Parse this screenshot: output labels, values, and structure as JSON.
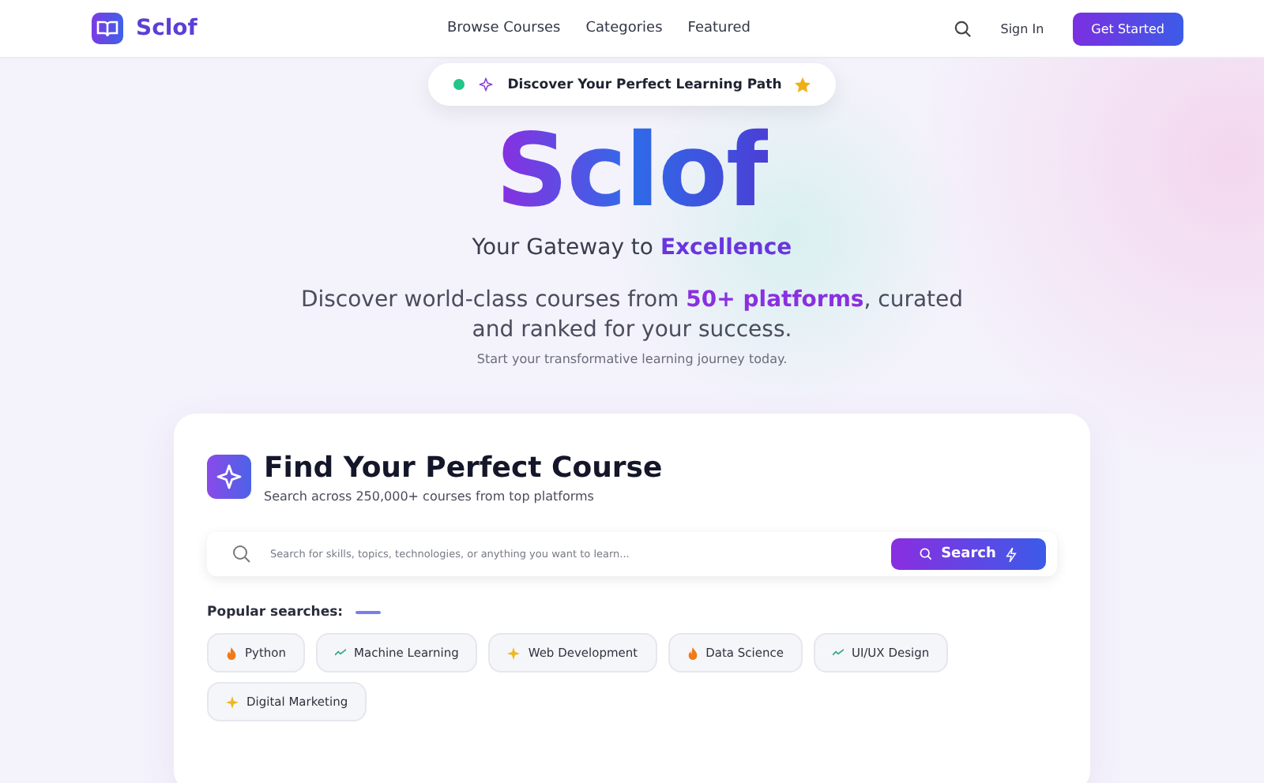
{
  "nav": {
    "logo": "Sclof",
    "links": [
      "Browse Courses",
      "Categories",
      "Featured"
    ],
    "sign_in": "Sign In",
    "cta": "Get Started"
  },
  "badge": {
    "text": "Discover Your Perfect Learning Path"
  },
  "hero": {
    "title": "Sclof",
    "tagline": "Your Gateway to **Excellence**",
    "description": "Discover world-class courses from **50+ platforms**, curated and ranked for your success.",
    "subtext": "Start your transformative learning journey today."
  },
  "finder": {
    "title": "Find Your Perfect Course",
    "subtitle": "Search across 250,000+ courses from top platforms",
    "placeholder": "Search for skills, topics, technologies, or anything you want to learn...",
    "button": "Search",
    "popular_label": "Popular searches:",
    "chips": [
      {
        "label": "Python",
        "kind": "hot"
      },
      {
        "label": "Machine Learning",
        "kind": "trending"
      },
      {
        "label": "Web Development",
        "kind": "new"
      },
      {
        "label": "Data Science",
        "kind": "hot"
      },
      {
        "label": "UI/UX Design",
        "kind": "trending"
      },
      {
        "label": "Digital Marketing",
        "kind": "new"
      }
    ]
  }
}
